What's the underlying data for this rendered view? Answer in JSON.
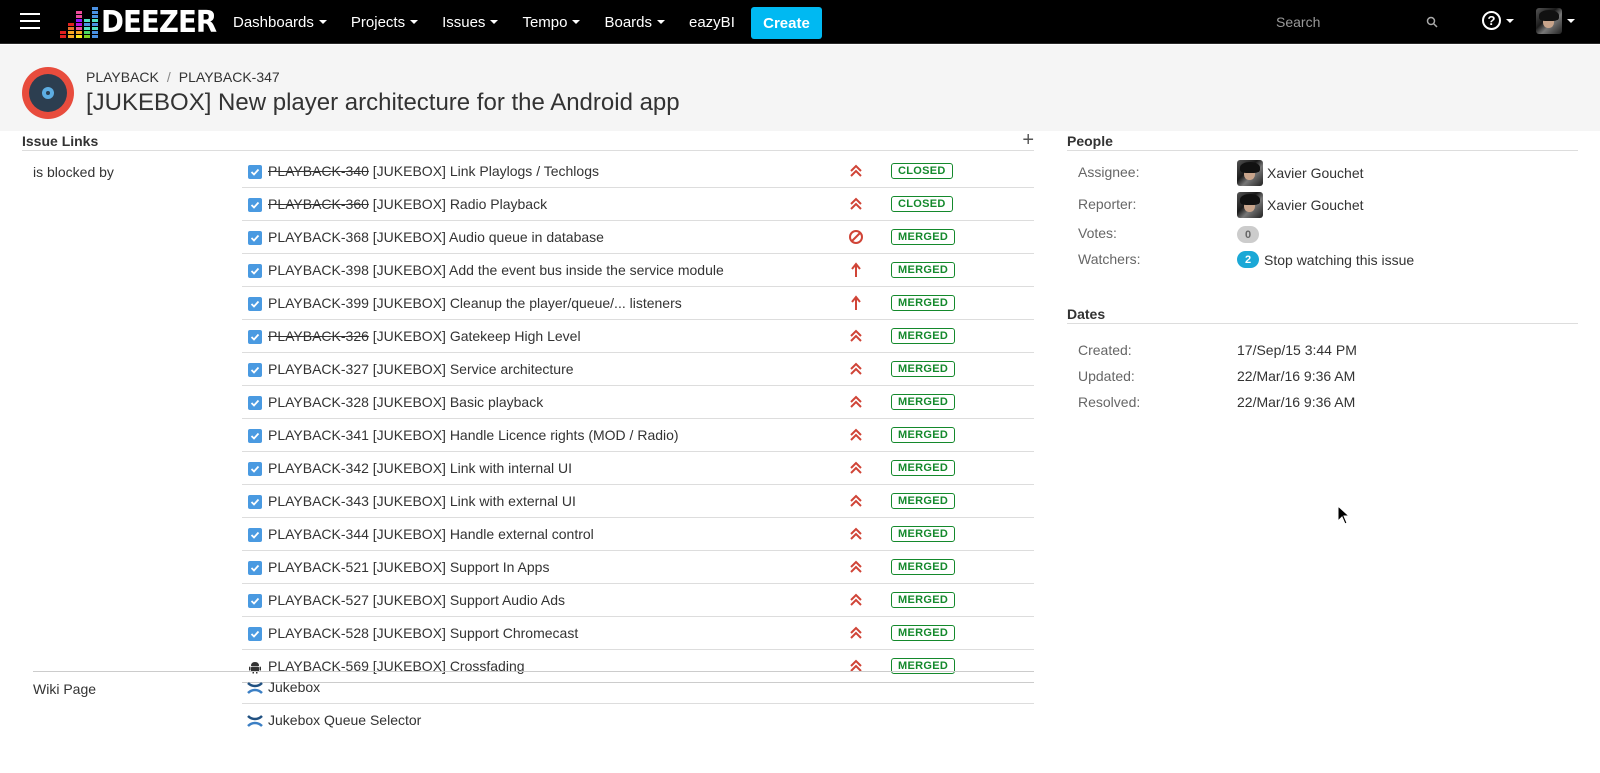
{
  "nav": {
    "logo_text": "DEEZER",
    "items": [
      {
        "label": "Dashboards",
        "has_caret": true
      },
      {
        "label": "Projects",
        "has_caret": true
      },
      {
        "label": "Issues",
        "has_caret": true
      },
      {
        "label": "Tempo",
        "has_caret": true
      },
      {
        "label": "Boards",
        "has_caret": true
      },
      {
        "label": "eazyBI",
        "has_caret": false
      }
    ],
    "create_label": "Create",
    "search_placeholder": "Search",
    "help_icon": "?"
  },
  "header": {
    "breadcrumbs": [
      "PLAYBACK",
      "PLAYBACK-347"
    ],
    "title": "[JUKEBOX] New player architecture for the Android app"
  },
  "issue_links": {
    "section_title": "Issue Links",
    "add_icon": "+",
    "relation_label": "is blocked by",
    "links": [
      {
        "key": "PLAYBACK-340",
        "summary": "[JUKEBOX] Link Playlogs / Techlogs",
        "resolved": true,
        "priority": "critical",
        "status": "CLOSED",
        "type": "task"
      },
      {
        "key": "PLAYBACK-360",
        "summary": "[JUKEBOX] Radio Playback",
        "resolved": true,
        "priority": "critical",
        "status": "CLOSED",
        "type": "task"
      },
      {
        "key": "PLAYBACK-368",
        "summary": "[JUKEBOX] Audio queue in database",
        "resolved": false,
        "priority": "blocker",
        "status": "MERGED",
        "type": "task"
      },
      {
        "key": "PLAYBACK-398",
        "summary": "[JUKEBOX] Add the event bus inside the service module",
        "resolved": false,
        "priority": "major",
        "status": "MERGED",
        "type": "task"
      },
      {
        "key": "PLAYBACK-399",
        "summary": "[JUKEBOX] Cleanup the player/queue/... listeners",
        "resolved": false,
        "priority": "major",
        "status": "MERGED",
        "type": "task"
      },
      {
        "key": "PLAYBACK-326",
        "summary": "[JUKEBOX] Gatekeep High Level",
        "resolved": true,
        "priority": "critical",
        "status": "MERGED",
        "type": "task"
      },
      {
        "key": "PLAYBACK-327",
        "summary": "[JUKEBOX] Service architecture",
        "resolved": false,
        "priority": "critical",
        "status": "MERGED",
        "type": "task"
      },
      {
        "key": "PLAYBACK-328",
        "summary": "[JUKEBOX] Basic playback",
        "resolved": false,
        "priority": "critical",
        "status": "MERGED",
        "type": "task"
      },
      {
        "key": "PLAYBACK-341",
        "summary": "[JUKEBOX] Handle Licence rights (MOD / Radio)",
        "resolved": false,
        "priority": "critical",
        "status": "MERGED",
        "type": "task"
      },
      {
        "key": "PLAYBACK-342",
        "summary": "[JUKEBOX] Link with internal UI",
        "resolved": false,
        "priority": "critical",
        "status": "MERGED",
        "type": "task"
      },
      {
        "key": "PLAYBACK-343",
        "summary": "[JUKEBOX] Link with external UI",
        "resolved": false,
        "priority": "critical",
        "status": "MERGED",
        "type": "task"
      },
      {
        "key": "PLAYBACK-344",
        "summary": "[JUKEBOX] Handle external control",
        "resolved": false,
        "priority": "critical",
        "status": "MERGED",
        "type": "task"
      },
      {
        "key": "PLAYBACK-521",
        "summary": "[JUKEBOX] Support In Apps",
        "resolved": false,
        "priority": "critical",
        "status": "MERGED",
        "type": "task"
      },
      {
        "key": "PLAYBACK-527",
        "summary": "[JUKEBOX] Support Audio Ads",
        "resolved": false,
        "priority": "critical",
        "status": "MERGED",
        "type": "task"
      },
      {
        "key": "PLAYBACK-528",
        "summary": "[JUKEBOX] Support Chromecast",
        "resolved": false,
        "priority": "critical",
        "status": "MERGED",
        "type": "task"
      },
      {
        "key": "PLAYBACK-569",
        "summary": "[JUKEBOX] Crossfading",
        "resolved": false,
        "priority": "critical",
        "status": "MERGED",
        "type": "android"
      }
    ],
    "wiki_label": "Wiki Page",
    "wiki_pages": [
      "Jukebox",
      "Jukebox Queue Selector"
    ]
  },
  "people": {
    "section_title": "People",
    "assignee_label": "Assignee:",
    "assignee": "Xavier Gouchet",
    "reporter_label": "Reporter:",
    "reporter": "Xavier Gouchet",
    "votes_label": "Votes:",
    "votes": "0",
    "watchers_label": "Watchers:",
    "watchers": "2",
    "watch_action": "Stop watching this issue"
  },
  "dates": {
    "section_title": "Dates",
    "created_label": "Created:",
    "created": "17/Sep/15 3:44 PM",
    "updated_label": "Updated:",
    "updated": "22/Mar/16 9:36 AM",
    "resolved_label": "Resolved:",
    "resolved": "22/Mar/16 9:36 AM"
  },
  "colors": {
    "nav_bg": "#000000",
    "create_btn": "#00b9f2",
    "status_green": "#14892c",
    "priority_red": "#d04437",
    "task_blue": "#4a9ae1",
    "watchers_badge": "#1ba8d6"
  }
}
